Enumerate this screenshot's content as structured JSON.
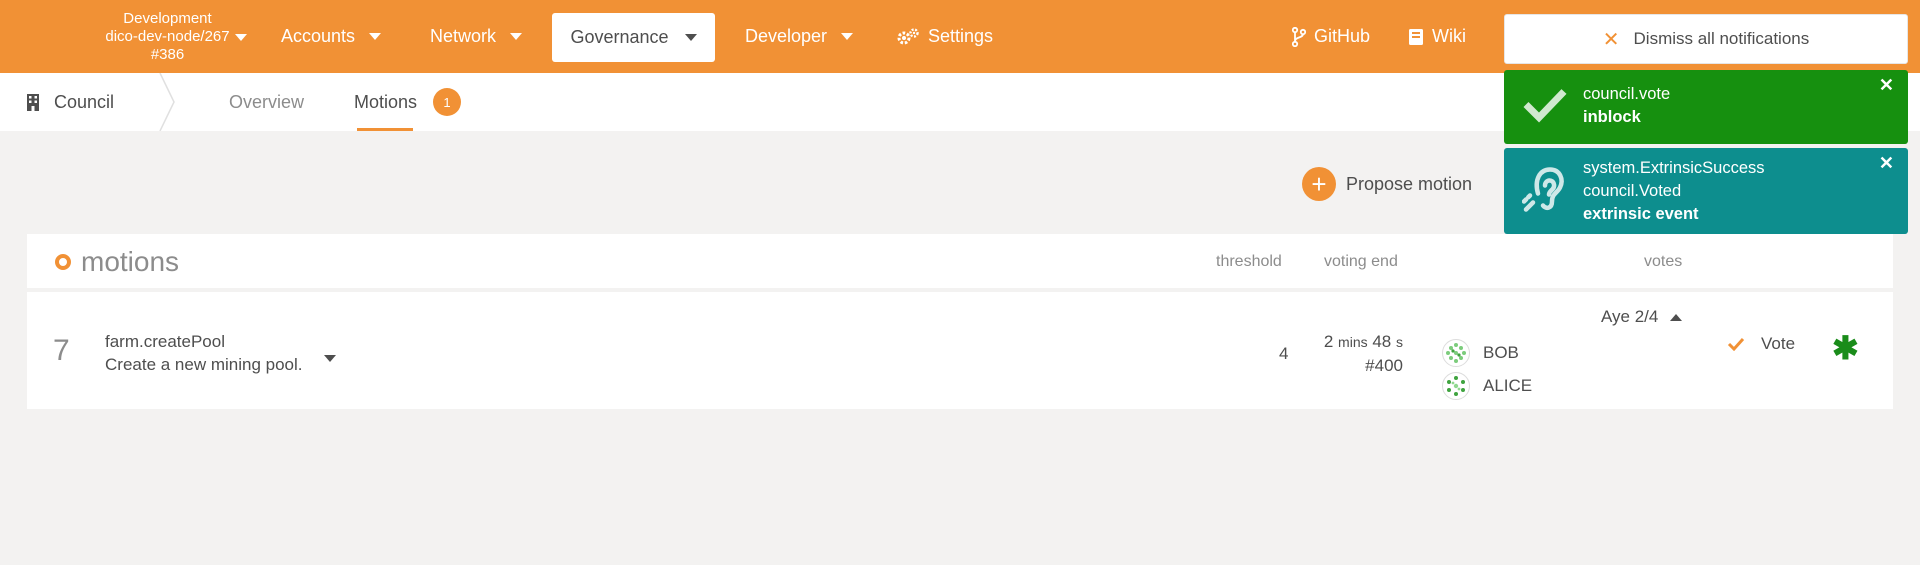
{
  "topbar": {
    "chain": {
      "line1": "Development",
      "line2": "dico-dev-node/267",
      "line3": "#386"
    },
    "nav": {
      "accounts": "Accounts",
      "network": "Network",
      "governance": "Governance",
      "developer": "Developer",
      "settings": "Settings",
      "github": "GitHub",
      "wiki": "Wiki"
    }
  },
  "subnav": {
    "section": "Council",
    "tabs": {
      "overview": "Overview",
      "motions": "Motions"
    },
    "motions_count": "1"
  },
  "actions": {
    "propose": "Propose motion"
  },
  "table": {
    "title": "motions",
    "headers": {
      "threshold": "threshold",
      "voting_end": "voting end",
      "votes": "votes"
    },
    "rows": [
      {
        "index": "7",
        "call": "farm.createPool",
        "description": "Create a new mining pool.",
        "threshold": "4",
        "voting_end_mins": "2",
        "voting_end_mins_unit": "mins",
        "voting_end_secs": "48",
        "voting_end_secs_unit": "s",
        "voting_end_block": "#400",
        "aye": "Aye 2/4",
        "voters": [
          "BOB",
          "ALICE"
        ],
        "vote_label": "Vote"
      }
    ]
  },
  "notifications": {
    "dismiss_all": "Dismiss all notifications",
    "items": [
      {
        "lines": [
          "council.vote"
        ],
        "status": "inblock",
        "color": "#16900f",
        "icon": "check-icon"
      },
      {
        "lines": [
          "system.ExtrinsicSuccess",
          "council.Voted"
        ],
        "status": "extrinsic event",
        "color": "#0d8e8e",
        "icon": "ear-icon"
      }
    ]
  },
  "colors": {
    "accent": "#f19135",
    "success": "#16900f",
    "info": "#0d8e8e"
  }
}
